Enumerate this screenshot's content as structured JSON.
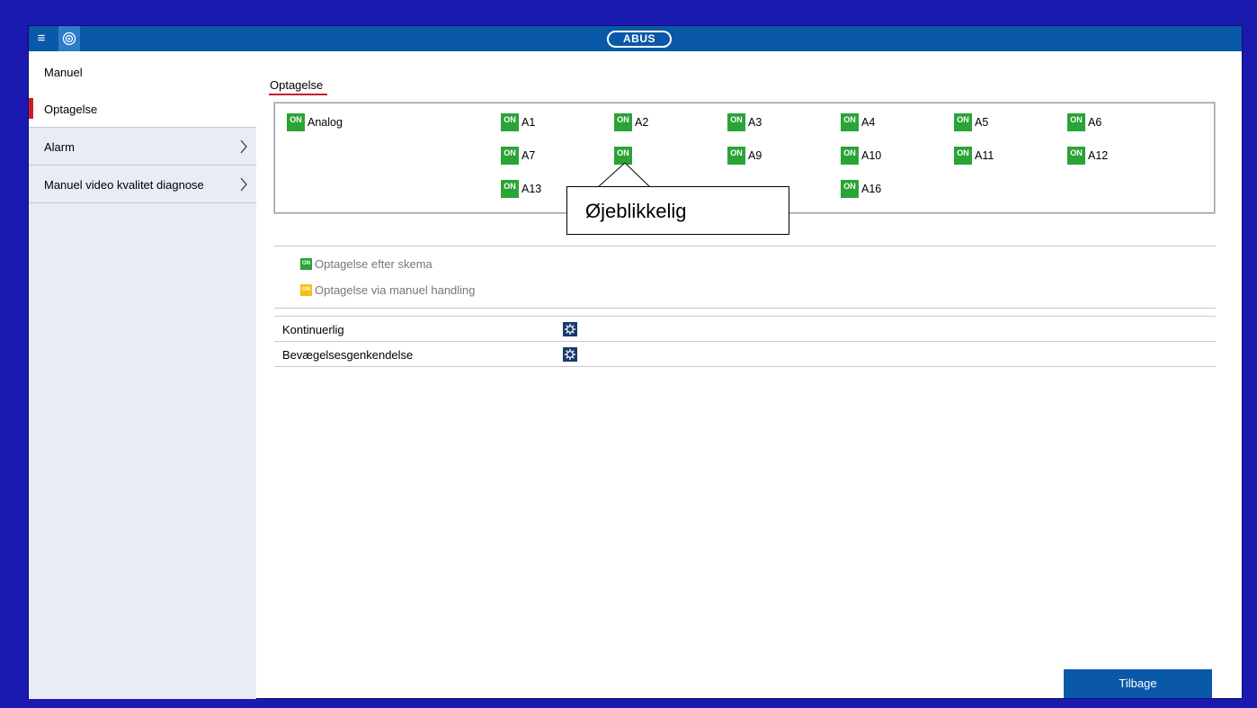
{
  "header": {
    "menu_icon": "hamburger-icon",
    "eye_icon": "eye-icon",
    "logo_text": "ABUS"
  },
  "sidebar": {
    "header": "Manuel",
    "items": [
      {
        "label": "Optagelse",
        "active": true,
        "has_chevron": false
      },
      {
        "label": "Alarm",
        "active": false,
        "has_chevron": true
      },
      {
        "label": "Manuel video kvalitet diagnose",
        "active": false,
        "has_chevron": true
      }
    ]
  },
  "main": {
    "tab": "Optagelse",
    "analog": {
      "badge": "ON",
      "label": "Analog"
    },
    "cameras": [
      {
        "badge": "ON",
        "label": "A1"
      },
      {
        "badge": "ON",
        "label": "A2"
      },
      {
        "badge": "ON",
        "label": "A3"
      },
      {
        "badge": "ON",
        "label": "A4"
      },
      {
        "badge": "ON",
        "label": "A5"
      },
      {
        "badge": "ON",
        "label": "A6"
      },
      {
        "badge": "ON",
        "label": "A7"
      },
      {
        "badge": "ON",
        "label": "A9"
      },
      {
        "badge": "ON",
        "label": "A10"
      },
      {
        "badge": "ON",
        "label": "A11"
      },
      {
        "badge": "ON",
        "label": "A12"
      },
      {
        "badge": "ON",
        "label": "A13"
      },
      {
        "badge": "ON",
        "label": "A16"
      }
    ],
    "tooltip": "Øjeblikkelig",
    "legend": [
      {
        "badge": "ON",
        "label": "Optagelse efter skema",
        "color": "#2aa337"
      },
      {
        "badge": "ON",
        "label": "Optagelse via manuel handling",
        "color": "#f5c013"
      }
    ],
    "rows": [
      {
        "label": "Kontinuerlig",
        "icon": "settings-icon"
      },
      {
        "label": "Bevægelsesgenkendelse",
        "icon": "settings-icon"
      }
    ],
    "back_button": "Tilbage"
  },
  "colors": {
    "accent": "#0a58a8",
    "active_marker": "#d31b24",
    "on_green": "#2aa337",
    "on_yellow": "#f5c013",
    "outer_border": "#1a1ab0"
  }
}
